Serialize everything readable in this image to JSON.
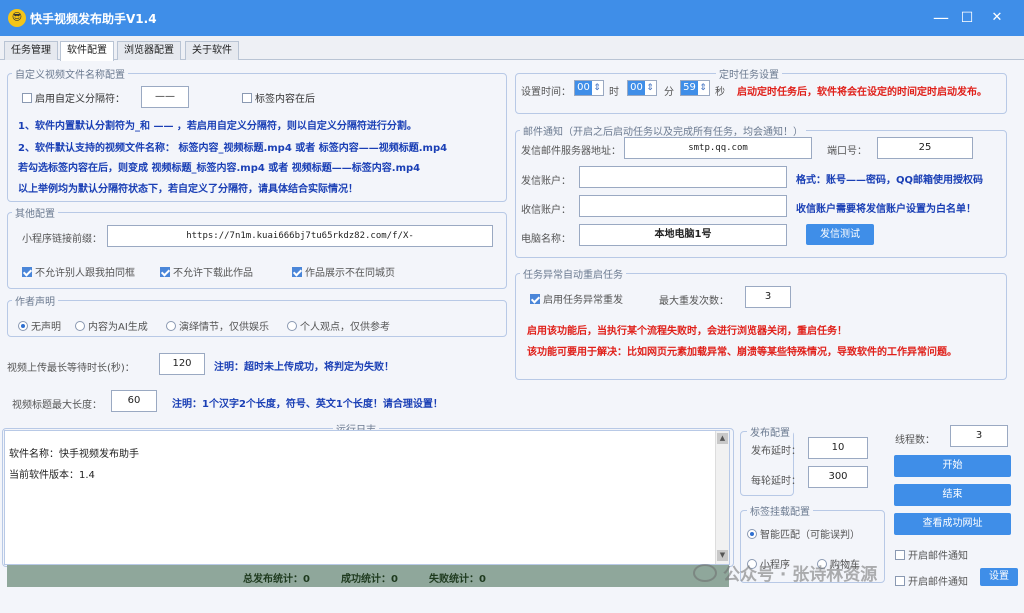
{
  "window": {
    "title": "快手视频发布助手V1.4",
    "minimize": "—",
    "maximize": "☐",
    "close": "✕"
  },
  "tabs": [
    "任务管理",
    "软件配置",
    "浏览器配置",
    "关于软件"
  ],
  "filename_group": {
    "legend": "自定义视频文件名称配置",
    "enable_separator_label": "启用自定义分隔符：",
    "separator_value": "——",
    "tag_after_label": "标签内容在后",
    "line1": "1、软件内置默认分割符为_和  ——  ，若启用自定义分隔符，则以自定义分隔符进行分割。",
    "line2": "2、软件默认支持的视频文件名称：  标签内容_视频标题.mp4 或者 标签内容——视频标题.mp4",
    "line3": "若勾选标签内容在后，则变成 视频标题_标签内容.mp4 或者 视频标题——标签内容.mp4",
    "line4": "以上举例均为默认分隔符状态下，若自定义了分隔符，请具体结合实际情况！"
  },
  "other_group": {
    "legend": "其他配置",
    "mini_link_label": "小程序链接前缀：",
    "mini_link_value": "https://7n1m.kuai666bj7tu65rkdz82.com/f/X-",
    "no_follow": "不允许别人跟我拍同框",
    "no_download": "不允许下载此作品",
    "no_city": "作品展示不在同城页"
  },
  "author_group": {
    "legend": "作者声明",
    "options": [
      "无声明",
      "内容为AI生成",
      "演绎情节，仅供娱乐",
      "个人观点，仅供参考"
    ]
  },
  "upload_wait": {
    "label": "视频上传最长等待时长(秒)：",
    "value": "120",
    "note": "注明：超时未上传成功，将判定为失败！"
  },
  "title_len": {
    "label": "视频标题最大长度：",
    "value": "60",
    "note": "注明：1个汉字2个长度，符号、英文1个长度！请合理设置！"
  },
  "timer_group": {
    "legend": "定时任务设置",
    "label": "设置时间：",
    "hour": "00",
    "hour_unit": "时",
    "minute": "00",
    "minute_unit": "分",
    "second": "59",
    "second_unit": "秒",
    "note": "启动定时任务后，软件将会在设定的时间定时启动发布。"
  },
  "mail_group": {
    "legend": "邮件通知（开启之后启动任务以及完成所有任务，均会通知！）",
    "server_label": "发信邮件服务器地址：",
    "server_value": "smtp.qq.com",
    "port_label": "端口号：",
    "port_value": "25",
    "sender_label": "发信账户：",
    "sender_note": "格式：账号——密码，QQ邮箱使用授权码",
    "receiver_label": "收信账户：",
    "receiver_note": "收信账户需要将发信账户设置为白名单！",
    "pc_label": "电脑名称：",
    "pc_value": "本地电脑1号",
    "test_button": "发信测试"
  },
  "restart_group": {
    "legend": "任务异常自动重启任务",
    "enable_label": "启用任务异常重发",
    "max_label": "最大重发次数：",
    "max_value": "3",
    "note1": "启用该功能后，当执行某个流程失败时，会进行浏览器关闭，重启任务！",
    "note2": "该功能可要用于解决：比如网页元素加载异常、崩溃等某些特殊情况，导致软件的工作异常问题。"
  },
  "log_group": {
    "legend": "运行日志",
    "lines": [
      "软件名称：快手视频发布助手",
      "当前软件版本：1.4"
    ]
  },
  "stats": {
    "total": "总发布统计：0",
    "success": "成功统计：0",
    "fail": "失败统计：0"
  },
  "publish_group": {
    "legend": "发布配置",
    "delay_label": "发布延时：",
    "delay_value": "10",
    "round_label": "每轮延时：",
    "round_value": "300"
  },
  "tag_group": {
    "legend": "标签挂载配置",
    "smart": "智能匹配（可能误判）",
    "mini": "小程序",
    "shop": "购物车"
  },
  "threads": {
    "label": "线程数：",
    "value": "3"
  },
  "buttons": {
    "start": "开始",
    "stop": "结束",
    "view": "查看成功网址",
    "set": "设置"
  },
  "mail_notify": {
    "label": "开启邮件通知",
    "label2": "开启邮件通知"
  },
  "watermark": "公众号 · 张诗林资源"
}
